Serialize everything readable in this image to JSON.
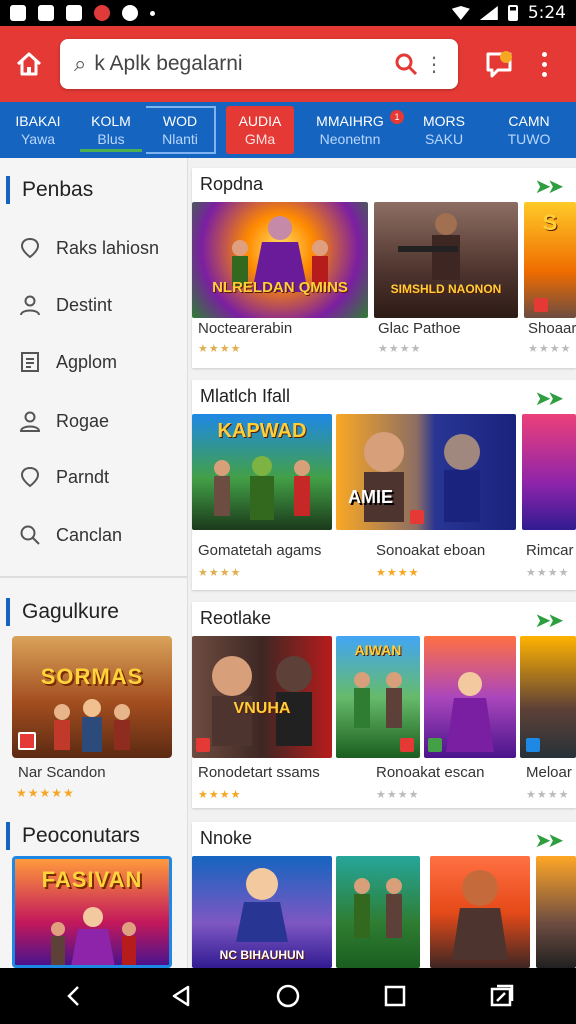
{
  "status": {
    "time": "5:24"
  },
  "search": {
    "value": "k Aplk begalarni",
    "placeholder": ""
  },
  "tabs": [
    {
      "line1": "IBAKAI",
      "line2": "Yawa"
    },
    {
      "line1": "KOLM",
      "line2": "Blus"
    },
    {
      "line1": "WOD",
      "line2": "Nlanti"
    },
    {
      "line1": "AUDIA",
      "line2": "GMa"
    },
    {
      "line1": "MMAIHRG",
      "line2": "Neonetnn",
      "badge": "1"
    },
    {
      "line1": "MORS",
      "line2": "SAKU"
    },
    {
      "line1": "CAMN",
      "line2": "TUWO"
    }
  ],
  "sidebar": {
    "title": "Penbas",
    "items": [
      {
        "label": "Raks lahiosn",
        "icon": "location-pin-icon"
      },
      {
        "label": "Destint",
        "icon": "person-icon"
      },
      {
        "label": "Agplom",
        "icon": "list-document-icon"
      },
      {
        "label": "Rogae",
        "icon": "person-outline-icon"
      },
      {
        "label": "Parndt",
        "icon": "location-pin-icon"
      },
      {
        "label": "Canclan",
        "icon": "search-icon"
      }
    ],
    "section2_title": "Gagulkure",
    "card1": {
      "art_text": "SORMAS",
      "name": "Nar Scandon",
      "stars": "★★★★★"
    },
    "section3_title": "Peoconutars",
    "card2": {
      "art_text": "FASIVAN"
    }
  },
  "sections": [
    {
      "title": "Ropdna",
      "tiles": [
        {
          "name": "Noctearerabin",
          "art": "NLRELDAN QMINS",
          "stars": "★★★★",
          "gold": false
        },
        {
          "name": "Glac Pathoe",
          "art": "SIMSHLD NAONON",
          "stars": "★★★★",
          "gold": false
        },
        {
          "name": "Shoaar",
          "art": "S",
          "stars": "★★★★",
          "gold": false
        }
      ]
    },
    {
      "title": "Mlatlch Ifall",
      "tiles": [
        {
          "name": "Gomatetah agams",
          "art": "KAPWAD",
          "stars": "★★★★",
          "gold": false
        },
        {
          "name": "Sonoakat eboan",
          "art": "AMIE",
          "stars": "★★★★",
          "gold": true
        },
        {
          "name": "Rimcar",
          "art": "",
          "stars": "★★★★",
          "gold": false
        }
      ]
    },
    {
      "title": "Reotlake",
      "tiles": [
        {
          "name": "Ronodetart ssams",
          "art": "VNUHA",
          "stars": "★★★★",
          "gold": true
        },
        {
          "name": "Ronoakat escan",
          "art": "AIWAN",
          "stars": "★★★★",
          "gold": false
        },
        {
          "name": "Meloar",
          "art": "",
          "stars": "★★★★",
          "gold": false
        }
      ]
    },
    {
      "title": "Nnoke",
      "tiles": [
        {
          "name": "",
          "art": "NC BIHAUHUN",
          "stars": "",
          "gold": false
        }
      ]
    }
  ]
}
